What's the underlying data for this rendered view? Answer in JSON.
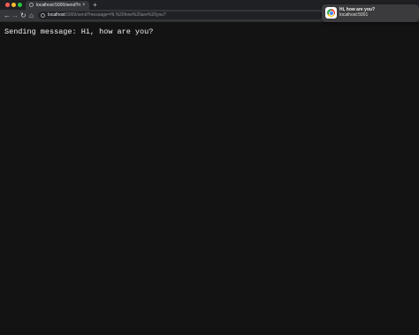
{
  "browser": {
    "tab": {
      "title": "localhost:5000/send?message=",
      "close_glyph": "×",
      "icon": "globe-icon"
    },
    "new_tab_glyph": "+",
    "toolbar": {
      "back_glyph": "←",
      "forward_glyph": "→",
      "reload_glyph": "↻",
      "home_glyph": "⌂",
      "url_host": "localhost",
      "url_rest": ":5000/send?message=Hi,%20how%20are%20you?"
    }
  },
  "page": {
    "message": "Sending message: Hi, how are you?"
  },
  "notification": {
    "title": "Hi, how are you?",
    "body": "localhost:5001",
    "icon": "chrome-icon"
  },
  "colors": {
    "background": "#131313",
    "tab_active": "#35363a",
    "notification_bg": "#3b3b3d"
  }
}
